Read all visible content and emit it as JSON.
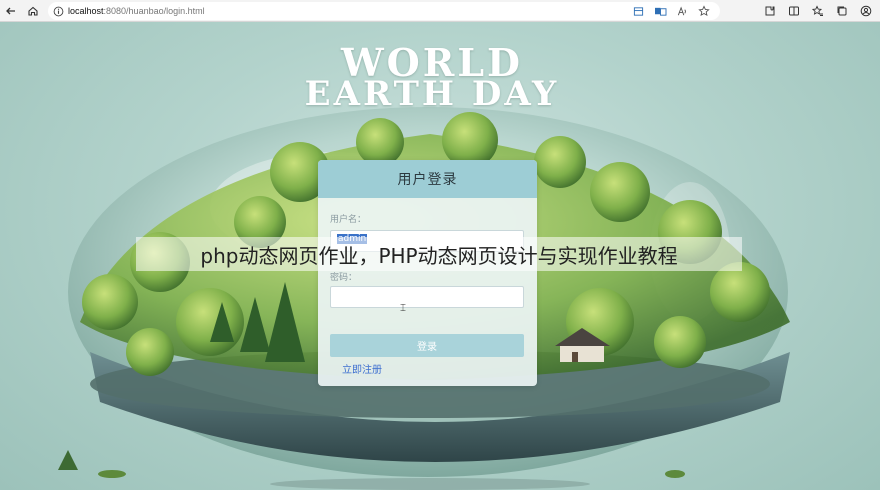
{
  "browser": {
    "url_host": "localhost",
    "url_path": ":8080/huanbao/login.html",
    "icons": [
      "back-icon",
      "home-icon",
      "info-icon",
      "grid-icon",
      "translate-icon",
      "read-aloud-icon",
      "favorite-icon",
      "extensions-icon",
      "split-screen-icon",
      "favorites-bar-icon",
      "collections-icon",
      "profile-icon"
    ]
  },
  "banner": {
    "line1": "WORLD",
    "line2": "EARTH DAY"
  },
  "login": {
    "title": "用户登录",
    "username_label": "用户名：",
    "username_value": "admin",
    "password_label": "密码：",
    "password_value": "",
    "submit_label": "登录",
    "register_link": "立即注册"
  },
  "watermark": "php动态网页作业，PHP动态网页设计与实现作业教程",
  "colors": {
    "card_header": "#9dcdd5",
    "button": "#a9d3da",
    "link": "#3d6fd0",
    "background": "#b3d3cc"
  }
}
